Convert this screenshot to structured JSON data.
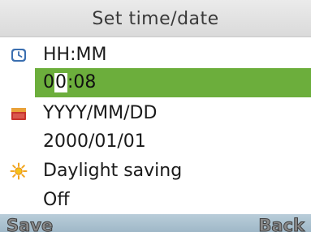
{
  "header": {
    "title": "Set time/date"
  },
  "time": {
    "icon": "clock-icon",
    "label": "HH:MM",
    "value_before": "0",
    "value_cursor": "0",
    "value_after": ":08"
  },
  "date": {
    "icon": "calendar-icon",
    "label": "YYYY/MM/DD",
    "value": "2000/01/01"
  },
  "dst": {
    "icon": "sun-icon",
    "label": "Daylight saving",
    "value": "Off"
  },
  "softkeys": {
    "left": "Save",
    "right": "Back"
  },
  "colors": {
    "highlight": "#6cae3c",
    "softkey_bar": "#a9c0cf",
    "title_bar": "#e2e2e2"
  }
}
